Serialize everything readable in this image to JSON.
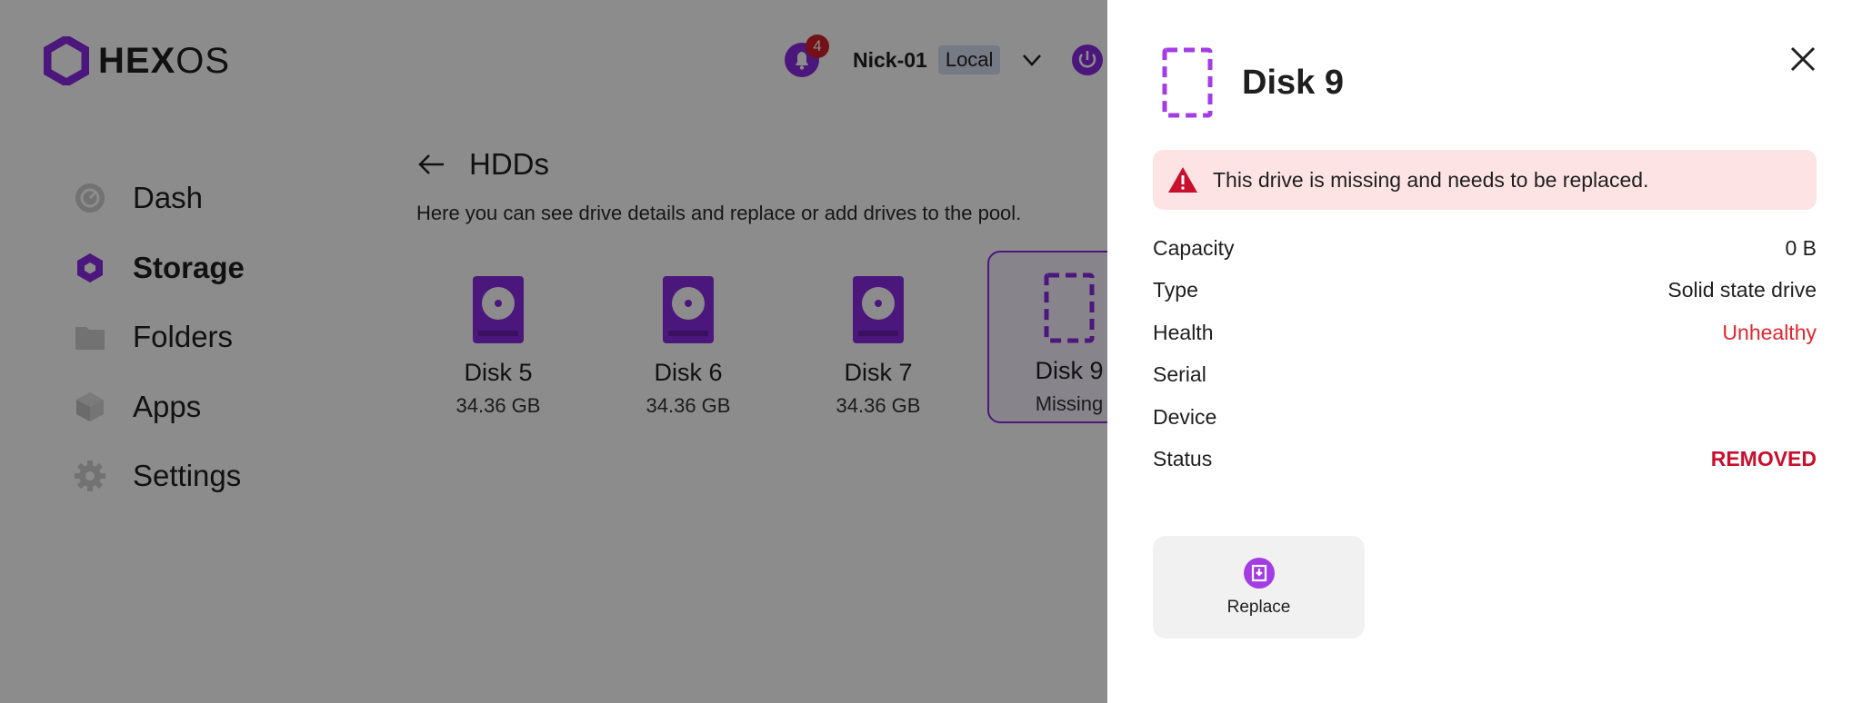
{
  "app": {
    "logo_bold": "HEX",
    "logo_light": "OS"
  },
  "topbar": {
    "notification_count": "4",
    "server_name": "Nick-01",
    "server_mode": "Local"
  },
  "sidebar": {
    "items": [
      {
        "label": "Dash",
        "icon": "dashboard-icon"
      },
      {
        "label": "Storage",
        "icon": "storage-icon",
        "active": true
      },
      {
        "label": "Folders",
        "icon": "folder-icon"
      },
      {
        "label": "Apps",
        "icon": "apps-icon"
      },
      {
        "label": "Settings",
        "icon": "gear-icon"
      }
    ]
  },
  "content": {
    "title": "HDDs",
    "description": "Here you can see drive details and replace or add drives to the pool.",
    "disks": [
      {
        "name": "Disk 5",
        "size": "34.36 GB"
      },
      {
        "name": "Disk 6",
        "size": "34.36 GB"
      },
      {
        "name": "Disk 7",
        "size": "34.36 GB"
      },
      {
        "name": "Disk 9",
        "size": "Missing",
        "missing": true
      }
    ]
  },
  "drawer": {
    "title": "Disk 9",
    "alert": "This drive is missing and needs to be replaced.",
    "details": [
      {
        "label": "Capacity",
        "value": "0 B"
      },
      {
        "label": "Type",
        "value": "Solid state drive"
      },
      {
        "label": "Health",
        "value": "Unhealthy"
      },
      {
        "label": "Serial",
        "value": ""
      },
      {
        "label": "Device",
        "value": ""
      },
      {
        "label": "Status",
        "value": "REMOVED"
      }
    ],
    "replace_label": "Replace"
  },
  "colors": {
    "accent": "#8a2be2",
    "danger": "#e0262f",
    "alert_bg": "#fde3e3"
  }
}
